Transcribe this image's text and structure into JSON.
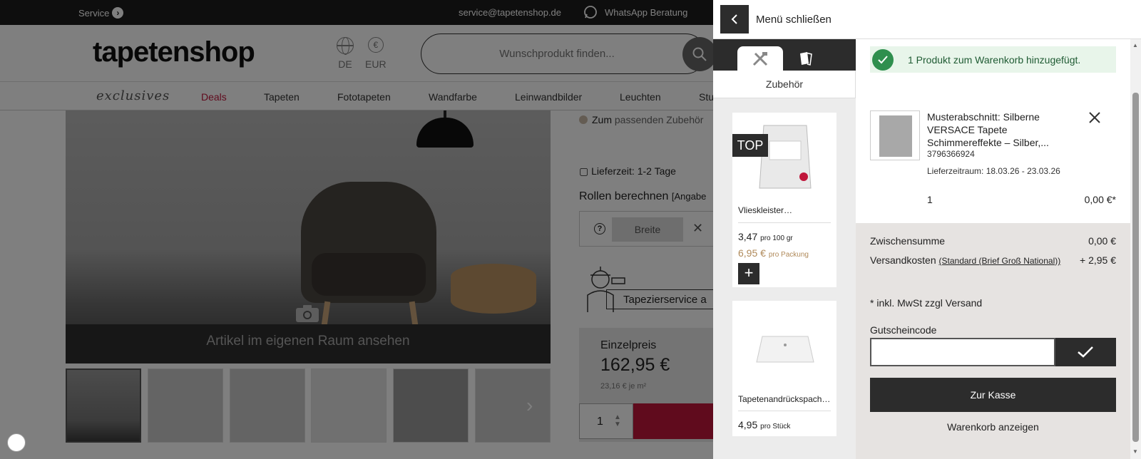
{
  "topbar": {
    "service": "Service",
    "email": "service@tapetenshop.de",
    "whatsapp": "WhatsApp Beratung"
  },
  "header": {
    "logo": "tapetenshop",
    "language": "DE",
    "currency_symbol": "€",
    "currency": "EUR",
    "search_placeholder": "Wunschprodukt finden..."
  },
  "nav": {
    "exclusives": "exclusives",
    "items": [
      "Deals",
      "Tapeten",
      "Fototapeten",
      "Wandfarbe",
      "Leinwandbilder",
      "Leuchten",
      "Stu"
    ]
  },
  "product": {
    "room_view": "Artikel im eigenen Raum ansehen",
    "accessory_link_prefix": "Zum",
    "accessory_link": "passenden Zubehör",
    "delivery": "Lieferzeit: 1-2 Tage",
    "rolls_title": "Rollen berechnen",
    "rolls_hint": "[Angabe",
    "width_label": "Breite",
    "tapezier": "Tapezierservice a",
    "price_label": "Einzelpreis",
    "price": "162,95 €",
    "price_per": "23,16 € je m²",
    "qty": "1"
  },
  "drawer": {
    "close_label": "Menü schließen",
    "accessory_tab_label": "Zubehör",
    "accessories": [
      {
        "badge": "TOP",
        "name": "Vlieskleister…",
        "price": "3,47",
        "price_unit": "pro 100 gr",
        "price2": "6,95 €",
        "price2_unit": "pro Packung",
        "add": "+"
      },
      {
        "name": "Tapetenandrückspach…",
        "price": "4,95",
        "price_unit": "pro Stück"
      }
    ],
    "notice": "1 Produkt zum Warenkorb hinzugefügt.",
    "cart_item": {
      "name": "Musterabschnitt: Silberne VERSACE Tapete Schimmereffekte – Silber,...",
      "sku": "3796366924",
      "delivery": "Lieferzeitraum: 18.03.26 - 23.03.26",
      "qty": "1",
      "price": "0,00 €*"
    },
    "summary": {
      "subtotal_label": "Zwischensumme",
      "subtotal": "0,00 €",
      "shipping_label": "Versandkosten",
      "shipping_method": "(Standard (Brief Groß National))",
      "shipping": "+ 2,95 €",
      "vat_note": "* inkl. MwSt zzgl Versand",
      "voucher_label": "Gutscheincode",
      "voucher_value": "",
      "checkout": "Zur Kasse",
      "show_cart": "Warenkorb anzeigen"
    }
  },
  "colors": {
    "accent": "#c0163b",
    "dark": "#2c2c2c",
    "success": "#2f8f4e",
    "summary_bg": "#e6e3e1"
  }
}
